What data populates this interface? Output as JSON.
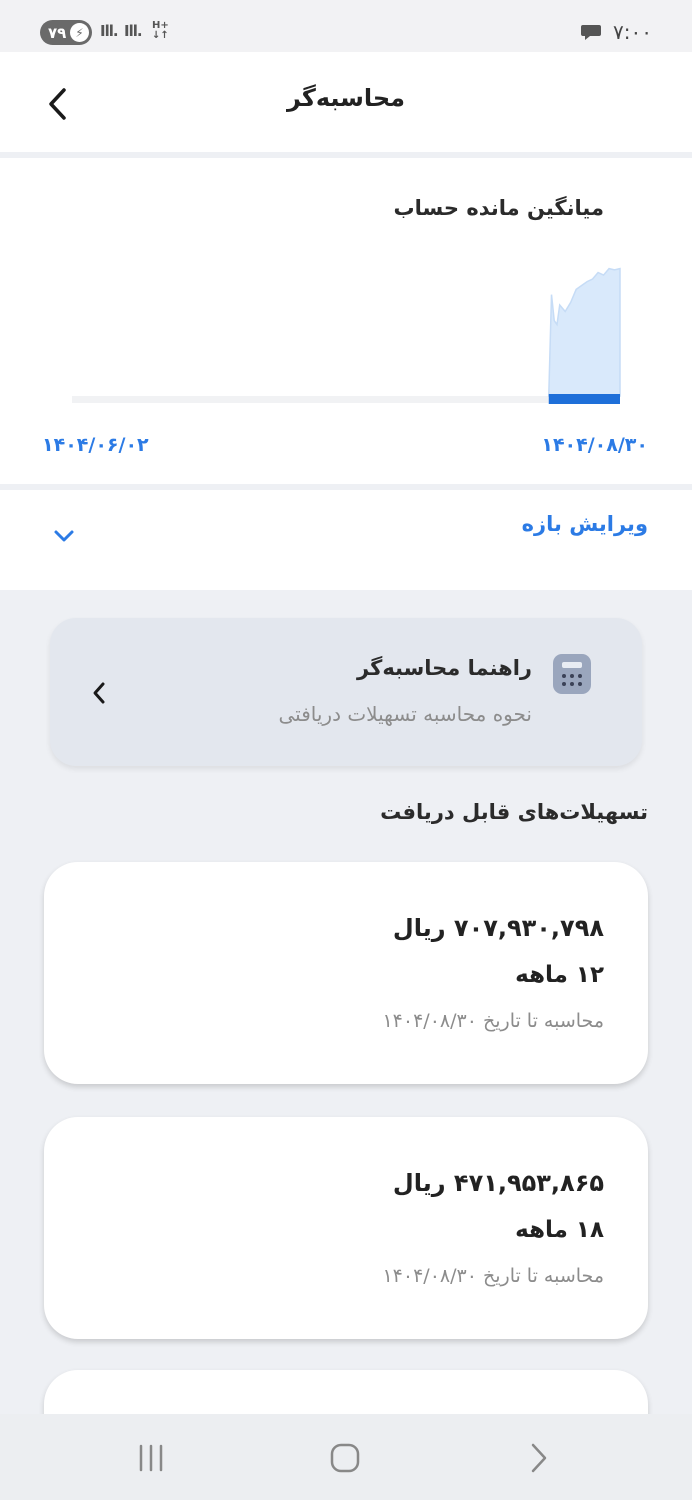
{
  "status_bar": {
    "time": "۷:۰۰",
    "battery": "۷۹",
    "network": "H+"
  },
  "header": {
    "title": "محاسبه‌گر"
  },
  "chart_card": {
    "title": "میانگین مانده حساب",
    "start_date": "۱۴۰۴/۰۶/۰۲",
    "end_date": "۱۴۰۴/۰۸/۳۰"
  },
  "chart_data": {
    "type": "area",
    "title": "میانگین مانده حساب",
    "x_range": [
      "۱۴۰۴/۰۶/۰۲",
      "۱۴۰۴/۰۸/۳۰"
    ],
    "x": [
      0.87,
      0.875,
      0.88,
      0.885,
      0.89,
      0.9,
      0.91,
      0.92,
      0.93,
      0.94,
      0.95,
      0.96,
      0.97,
      0.98,
      0.99,
      1.0
    ],
    "values": [
      0.0,
      0.78,
      0.58,
      0.55,
      0.7,
      0.65,
      0.72,
      0.82,
      0.85,
      0.88,
      0.9,
      0.95,
      0.93,
      0.98,
      0.97,
      0.98
    ],
    "selected_range": [
      0.87,
      1.0
    ],
    "colors": {
      "fill": "#d9e9fb",
      "line": "#c6dcf6",
      "track": "#f1f2f4",
      "selection": "#1e6fd9"
    }
  },
  "edit_range": {
    "label": "ویرایش بازه"
  },
  "guide": {
    "title": "راهنما محاسبه‌گر",
    "subtitle": "نحوه محاسبه تسهیلات دریافتی"
  },
  "facilities": {
    "section_title": "تسهیلات‌های قابل دریافت",
    "items": [
      {
        "amount": "۷۰۷,۹۳۰,۷۹۸ ریال",
        "term": "۱۲ ماهه",
        "date": "محاسبه تا تاریخ ۱۴۰۴/۰۸/۳۰"
      },
      {
        "amount": "۴۷۱,۹۵۳,۸۶۵ ریال",
        "term": "۱۸ ماهه",
        "date": "محاسبه تا تاریخ ۱۴۰۴/۰۸/۳۰"
      }
    ]
  },
  "colors": {
    "accent": "#2c7be5",
    "background": "#eef0f4",
    "card": "#ffffff"
  }
}
